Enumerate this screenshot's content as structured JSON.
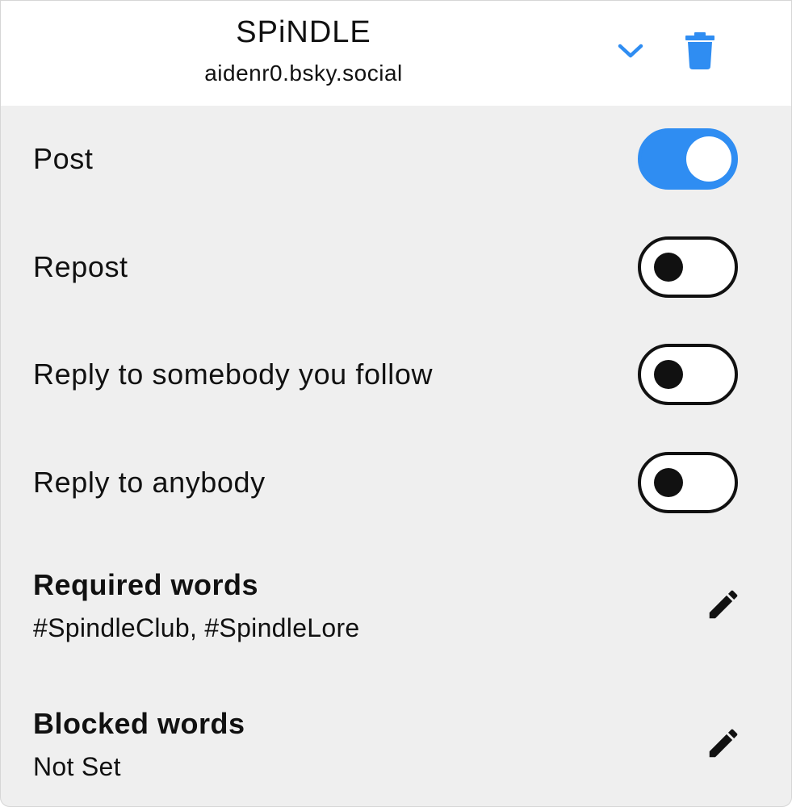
{
  "header": {
    "title": "SPiNDLE",
    "subtitle": "aidenr0.bsky.social",
    "expand_icon": "chevron-down-icon",
    "delete_icon": "trash-icon",
    "accent_color": "#2f8df2"
  },
  "toggles": [
    {
      "label": "Post",
      "on": true
    },
    {
      "label": "Repost",
      "on": false
    },
    {
      "label": "Reply to somebody you follow",
      "on": false
    },
    {
      "label": "Reply to anybody",
      "on": false
    }
  ],
  "required_words": {
    "title": "Required words",
    "value": "#SpindleClub, #SpindleLore",
    "edit_icon": "pencil-icon"
  },
  "blocked_words": {
    "title": "Blocked words",
    "value": "Not Set",
    "edit_icon": "pencil-icon"
  }
}
